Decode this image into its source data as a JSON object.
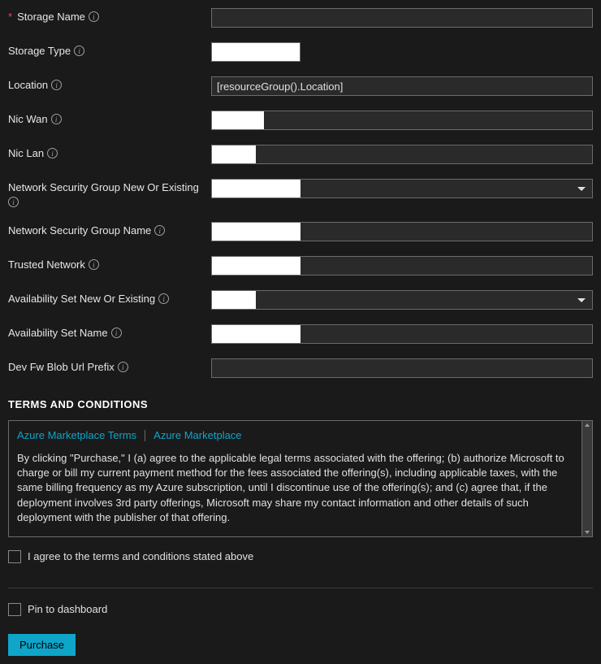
{
  "fields": {
    "storageName": {
      "label": "Storage Name",
      "required": true,
      "value": ""
    },
    "storageType": {
      "label": "Storage Type",
      "value": ""
    },
    "location": {
      "label": "Location",
      "value": "[resourceGroup().Location]"
    },
    "nicWan": {
      "label": "Nic Wan",
      "value": ""
    },
    "nicLan": {
      "label": "Nic Lan",
      "value": ""
    },
    "nsgNewOrExisting": {
      "label": "Network Security Group New Or Existing",
      "value": ""
    },
    "nsgName": {
      "label": "Network Security Group Name",
      "value": ""
    },
    "trustedNetwork": {
      "label": "Trusted Network",
      "value": ""
    },
    "availSetNewOrExisting": {
      "label": "Availability Set New Or Existing",
      "value": ""
    },
    "availSetName": {
      "label": "Availability Set Name",
      "value": ""
    },
    "devFwBlobUrlPrefix": {
      "label": "Dev Fw Blob Url Prefix",
      "value": ""
    }
  },
  "terms": {
    "heading": "TERMS AND CONDITIONS",
    "link1": "Azure Marketplace Terms",
    "link2": "Azure Marketplace",
    "body": "By clicking \"Purchase,\" I (a) agree to the applicable legal terms associated with the offering; (b) authorize Microsoft to charge or bill my current payment method for the fees associated the offering(s), including applicable taxes, with the same billing frequency as my Azure subscription, until I discontinue use of the offering(s); and (c) agree that, if the deployment involves 3rd party offerings, Microsoft may share my contact information and other details of such deployment with the publisher of that offering.",
    "agree_label": "I agree to the terms and conditions stated above"
  },
  "pin_label": "Pin to dashboard",
  "purchase_label": "Purchase"
}
